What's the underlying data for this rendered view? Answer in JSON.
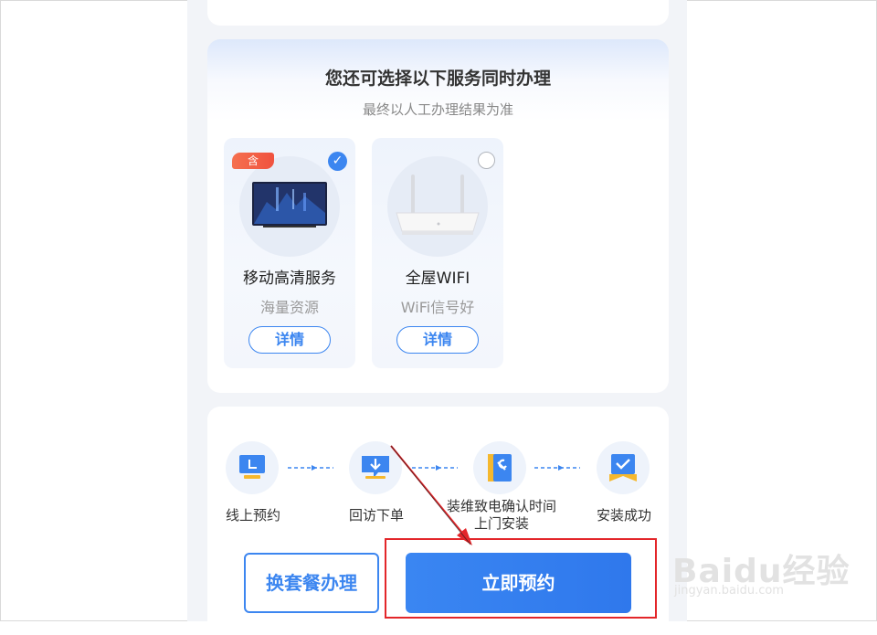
{
  "services": {
    "title": "您还可选择以下服务同时办理",
    "subtitle": "最终以人工办理结果为准",
    "options": [
      {
        "badge": "含",
        "name": "移动高清服务",
        "desc": "海量资源",
        "detail": "详情",
        "selected": true
      },
      {
        "badge": "",
        "name": "全屋WIFI",
        "desc": "WiFi信号好",
        "detail": "详情",
        "selected": false
      }
    ]
  },
  "process": {
    "steps": [
      {
        "label": "线上预约",
        "icon": "monitor-icon"
      },
      {
        "label": "回访下单",
        "icon": "download-message-icon"
      },
      {
        "label": "装维致电确认时间\n上门安装",
        "icon": "wrench-doc-icon"
      },
      {
        "label": "安装成功",
        "icon": "check-ribbon-icon"
      }
    ]
  },
  "actions": {
    "switch_plan": "换套餐办理",
    "book_now": "立即预约"
  },
  "watermark": {
    "brand": "Baidu经验",
    "url": "jingyan.baidu.com"
  },
  "colors": {
    "accent": "#3c86f0",
    "badge": "#f0523f",
    "highlight": "#e3262a"
  }
}
